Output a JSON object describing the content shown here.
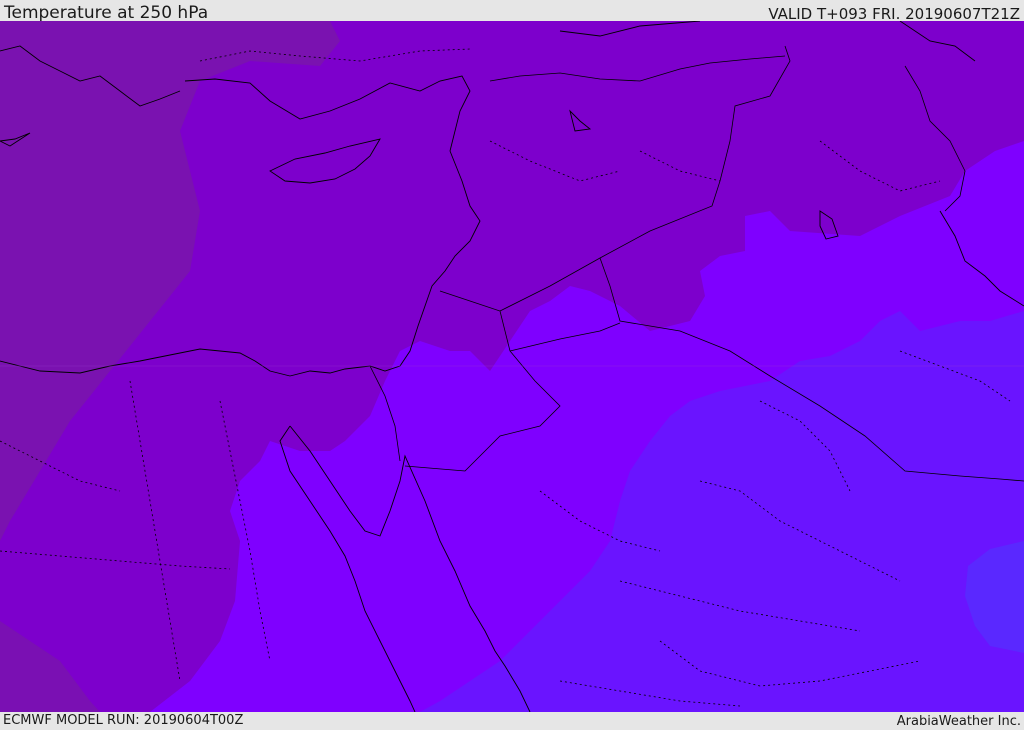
{
  "header": {
    "title": "Temperature at 250 hPa",
    "valid_time": "VALID T+093 FRI. 20190607T21Z"
  },
  "footer": {
    "model_run": "ECMWF MODEL RUN: 20190604T00Z",
    "credit": "ArabiaWeather Inc."
  },
  "map": {
    "field": "temperature-250hPa",
    "fill_colors": {
      "coldest_west": "#7a12b0",
      "cold": "#7d00cc",
      "mid": "#7f00ff",
      "warm": "#6a14ff",
      "warmest": "#5a28ff"
    },
    "boundary_color": "#000000"
  }
}
